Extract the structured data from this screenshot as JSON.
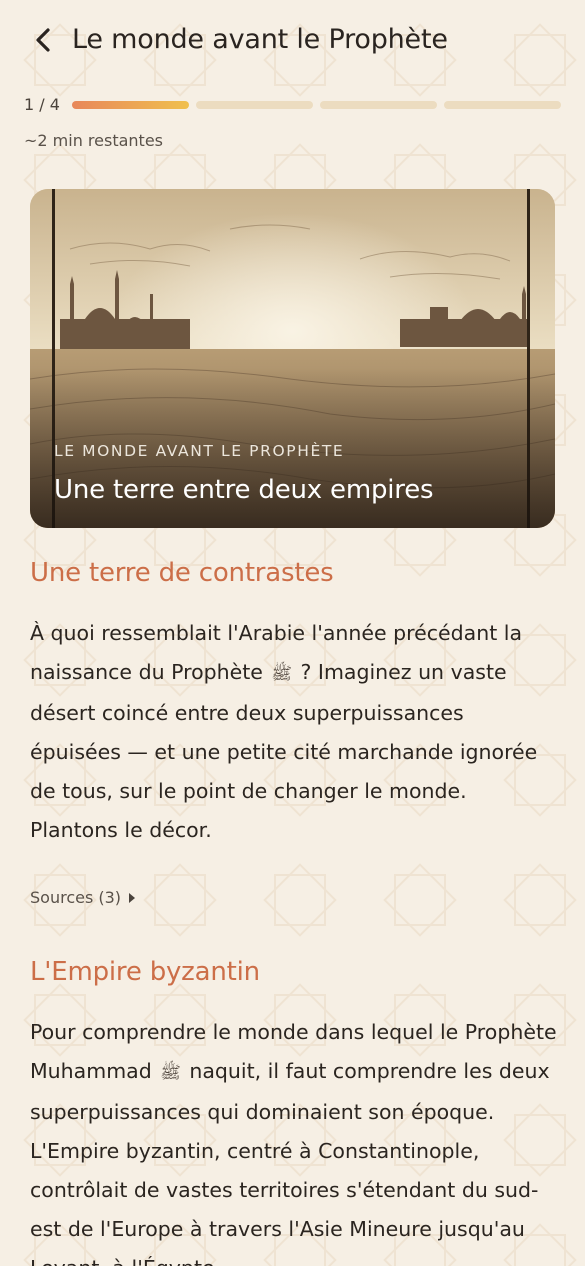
{
  "header": {
    "title": "Le monde avant le Prophète",
    "back_icon": "chevron-left-icon"
  },
  "progress": {
    "step_label": "1 / 4",
    "current_step": 1,
    "total_steps": 4,
    "remaining": "~2 min restantes",
    "accent_colors": [
      "#e8875a",
      "#f0c04e"
    ],
    "inactive_color": "#ecdcc0"
  },
  "hero": {
    "kicker": "LE MONDE AVANT LE PROPHÈTE",
    "title": "Une terre entre deux empires",
    "image": "desert-cities-illustration"
  },
  "sections": [
    {
      "heading": "Une terre de contrastes",
      "text_before": "À quoi ressemblait l'Arabie l'année précédant la naissance du Prophète",
      "glyph": "ﷺ",
      "text_after": "? Imaginez un vaste désert coincé entre deux superpuissances épuisées — et une petite cité marchande ignorée de tous, sur le point de changer le monde. Plantons le décor."
    },
    {
      "heading": "L'Empire byzantin",
      "text_before": "Pour comprendre le monde dans lequel le Prophète Muhammad",
      "glyph": "ﷺ",
      "text_after": "naquit, il faut comprendre les deux superpuissances qui dominaient son époque. L'Empire byzantin, centré à Constantinople, contrôlait de vastes territoires s'étendant du sud-est de l'Europe à travers l'Asie Mineure jusqu'au Levant, à l'Égypte"
    }
  ],
  "sources": {
    "label": "Sources (3)"
  },
  "colors": {
    "background": "#f6efe4",
    "heading": "#cc6e48",
    "text": "#2b2520"
  }
}
